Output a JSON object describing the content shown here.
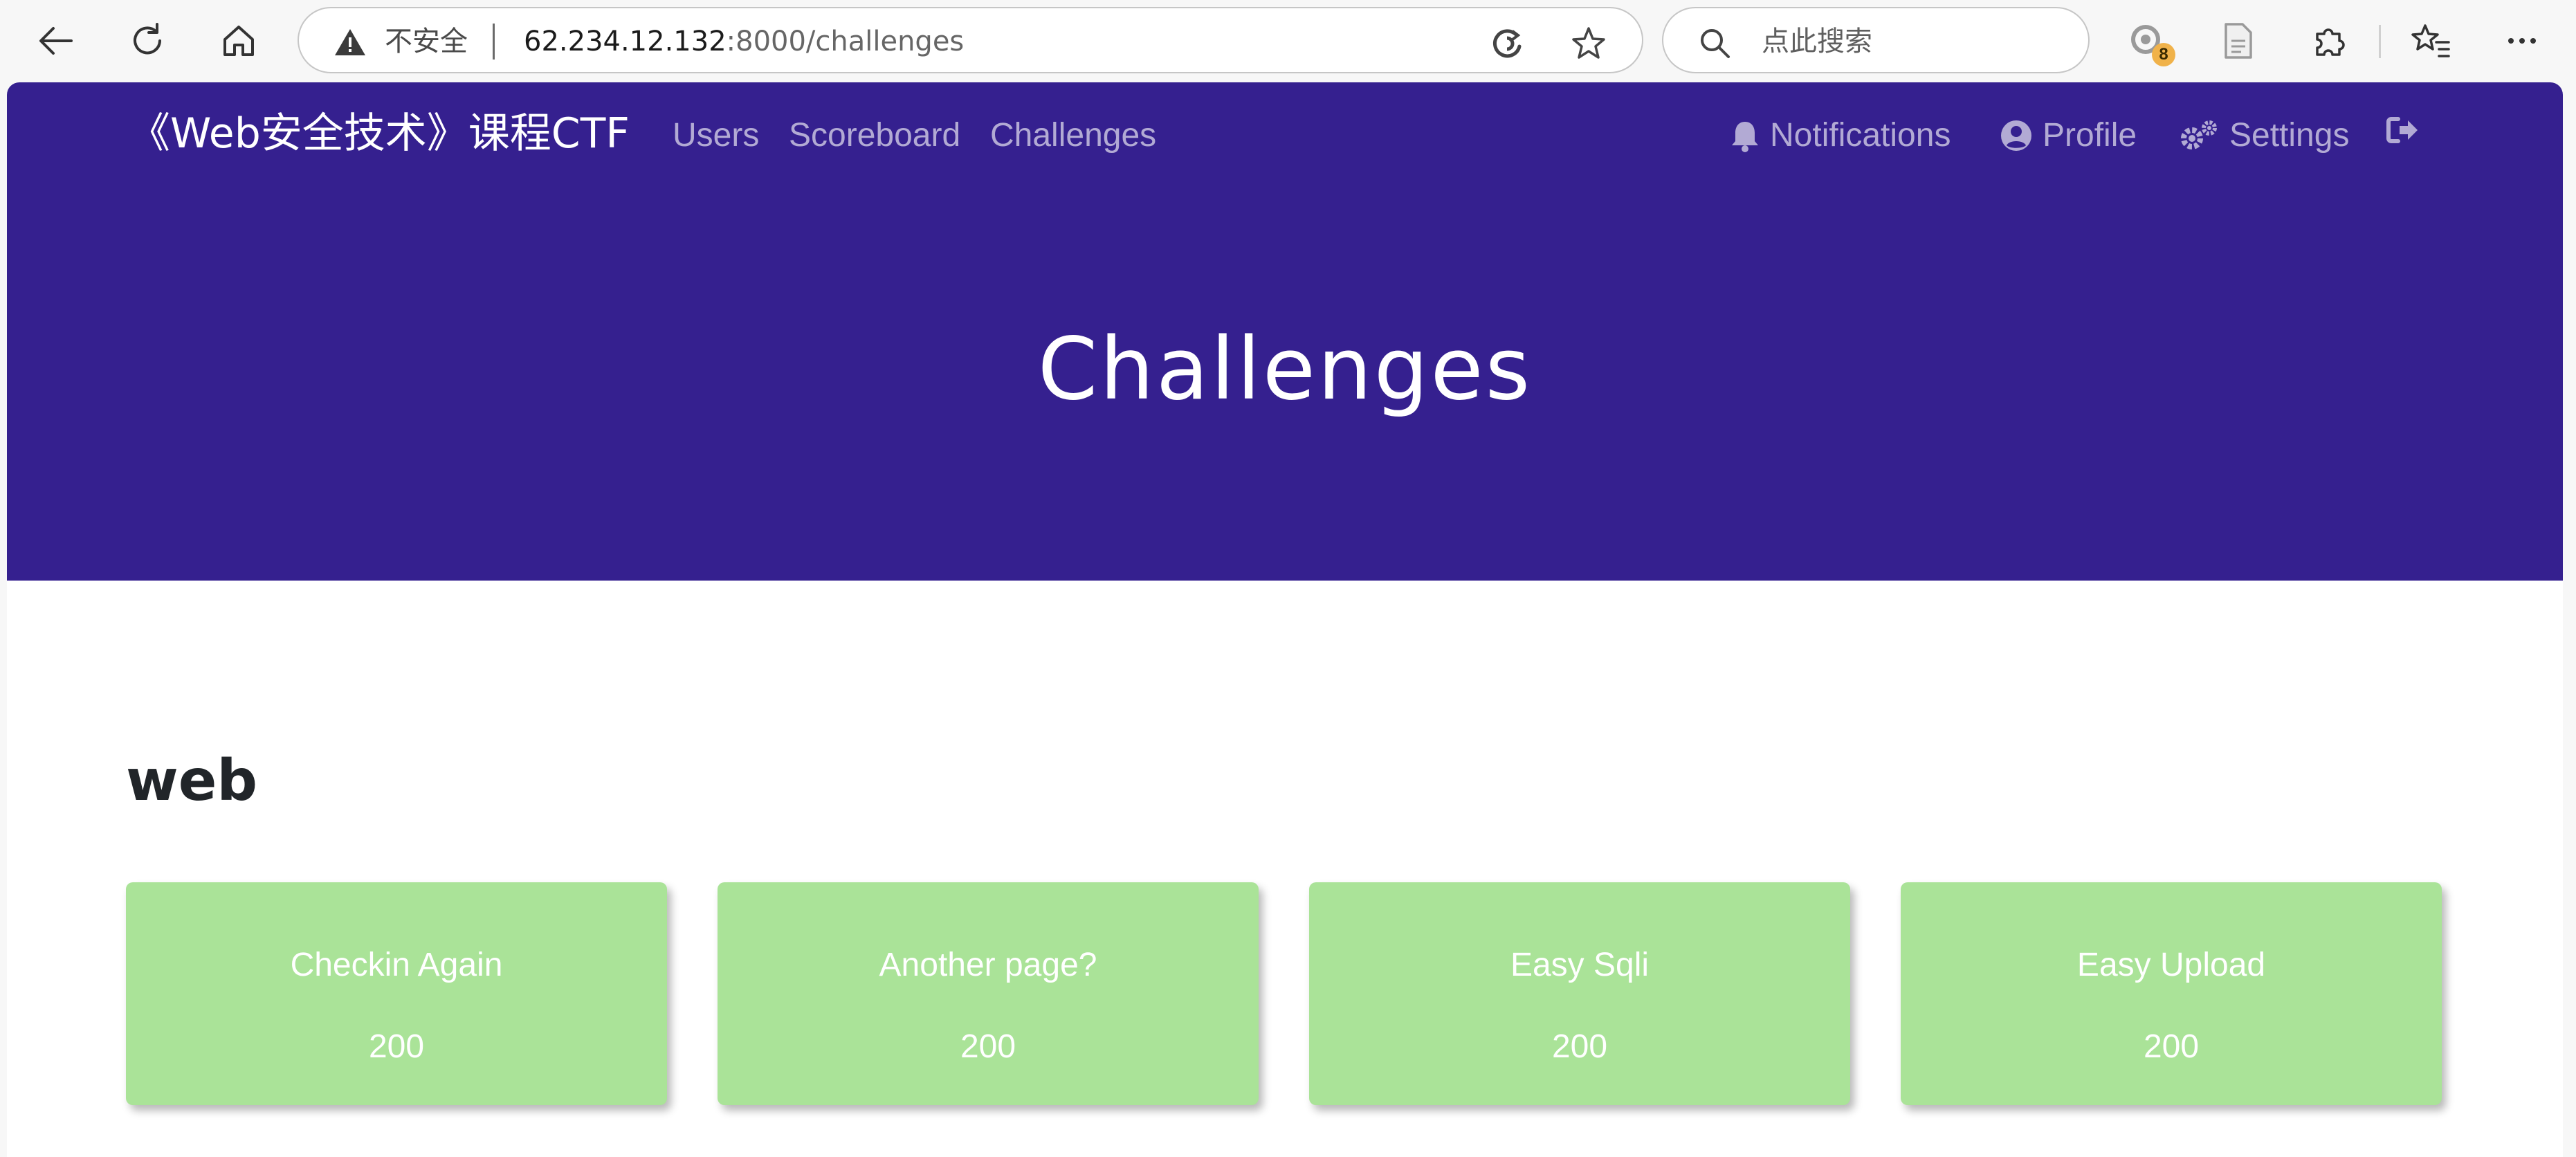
{
  "browser": {
    "security_label": "不安全",
    "url_host": "62.234.12.132",
    "url_path": ":8000/challenges",
    "search_placeholder": "点此搜索",
    "extension_badge": "8",
    "icons": [
      "back-icon",
      "refresh-icon",
      "home-icon",
      "warning-icon",
      "read-aloud-icon",
      "favorite-star-icon",
      "search-icon",
      "extension-icon",
      "document-icon",
      "puzzle-icon",
      "favorites-icon",
      "more-icon"
    ]
  },
  "navbar": {
    "brand": "《Web安全技术》课程CTF",
    "links": [
      {
        "label": "Users"
      },
      {
        "label": "Scoreboard"
      },
      {
        "label": "Challenges"
      }
    ],
    "right_links": [
      {
        "label": "Notifications",
        "icon": "bell-icon"
      },
      {
        "label": "Profile",
        "icon": "user-circle-icon"
      },
      {
        "label": "Settings",
        "icon": "gears-icon"
      },
      {
        "label": "",
        "icon": "logout-icon"
      }
    ]
  },
  "hero": {
    "title": "Challenges"
  },
  "category": {
    "name": "web",
    "challenges": [
      {
        "name": "Checkin Again",
        "value": "200"
      },
      {
        "name": "Another page?",
        "value": "200"
      },
      {
        "name": "Easy Sqli",
        "value": "200"
      },
      {
        "name": "Easy Upload",
        "value": "200"
      }
    ]
  },
  "colors": {
    "navbar_bg": "#35208f",
    "solved_card": "#aae398",
    "page_bg": "#ffffff"
  }
}
